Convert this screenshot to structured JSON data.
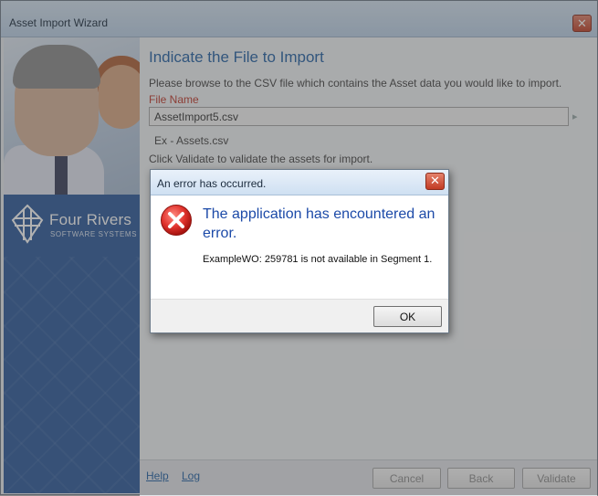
{
  "wizard": {
    "title": "Asset Import Wizard",
    "close_glyph": "✕",
    "brand": {
      "name": "Four Rivers",
      "tagline": "SOFTWARE SYSTEMS"
    },
    "content": {
      "heading": "Indicate the File to Import",
      "description": "Please browse to the CSV file which contains the Asset data you would like to import.",
      "file_label": "File Name",
      "file_value": "AssetImport5.csv",
      "example": "Ex - Assets.csv",
      "validate_hint": "Click Validate to validate the assets for import."
    },
    "footer": {
      "help": "Help",
      "log": "Log",
      "cancel": "Cancel",
      "back": "Back",
      "validate": "Validate"
    }
  },
  "dialog": {
    "title": "An error has occurred.",
    "close_glyph": "✕",
    "heading": "The application has encountered an error.",
    "message": "ExampleWO:  259781 is not available in Segment 1.",
    "ok": "OK"
  },
  "colors": {
    "accent": "#2563a6",
    "label_red": "#c0392b",
    "sidebar_blue": "#2d5a9b",
    "error_red": "#d9302c"
  },
  "icons": {
    "error": "error-circle-x-icon",
    "close": "close-icon",
    "logo": "four-rivers-logo-icon"
  }
}
